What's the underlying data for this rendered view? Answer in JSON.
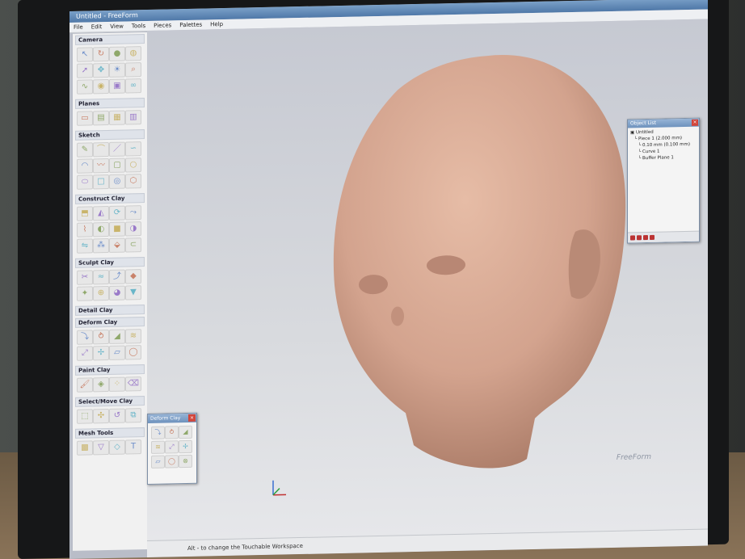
{
  "app": {
    "title": "Untitled - FreeForm",
    "menu": [
      "File",
      "Edit",
      "View",
      "Tools",
      "Pieces",
      "Palettes",
      "Help"
    ]
  },
  "palette": {
    "sections": [
      {
        "name": "Camera",
        "tools": [
          "select-icon",
          "rotate-view-icon",
          "sphere-icon",
          "globe-icon",
          "arrow-cursor-icon",
          "pan-icon",
          "light-icon",
          "zoom-icon",
          "path-icon",
          "camera-icon",
          "cube-icon",
          "loop-icon"
        ]
      },
      {
        "name": "Planes",
        "tools": [
          "plane-icon",
          "box-plane-icon",
          "color-plane-icon",
          "grid-plane-icon"
        ]
      },
      {
        "name": "Sketch",
        "tools": [
          "pencil-icon",
          "curve-icon",
          "line-icon",
          "spline-icon",
          "arc-icon",
          "wave-icon",
          "rect-icon",
          "circle-icon",
          "ellipse-icon",
          "square-icon",
          "ring-icon",
          "polygon-icon"
        ]
      },
      {
        "name": "Construct Clay",
        "tools": [
          "extrude-icon",
          "loft-icon",
          "revolve-icon",
          "sweep-icon",
          "wire-icon",
          "shell-icon",
          "block-icon",
          "blend-icon",
          "mirror-icon",
          "pattern-icon",
          "stamp-icon",
          "tube-icon"
        ]
      },
      {
        "name": "Sculpt Clay",
        "tools": [
          "carve-icon",
          "smooth-icon",
          "tug-icon",
          "emboss-icon",
          "spike-icon",
          "attract-icon",
          "wax-icon",
          "fill-icon"
        ]
      },
      {
        "name": "Detail Clay",
        "tools": []
      },
      {
        "name": "Deform Clay",
        "tools": [
          "bend-icon",
          "twist-icon",
          "taper-icon",
          "warp-icon",
          "scale-icon",
          "move-icon",
          "shear-icon",
          "inflate-icon"
        ]
      },
      {
        "name": "Paint Clay",
        "tools": [
          "brush-icon",
          "color-icon",
          "spray-icon",
          "eraser-icon"
        ]
      },
      {
        "name": "Select/Move Clay",
        "tools": [
          "select-clay-icon",
          "move-clay-icon",
          "rotate-clay-icon",
          "copy-clay-icon"
        ]
      },
      {
        "name": "Mesh Tools",
        "tools": [
          "mesh-icon",
          "reduce-icon",
          "weld-icon",
          "t-tool-icon"
        ]
      }
    ]
  },
  "object_list": {
    "title": "Object List",
    "items": [
      "Untitled",
      "Piece 1 (2.000 mm)",
      "0.10 mm (0.100 mm)",
      "Curve 1",
      "Buffer Plane 1"
    ]
  },
  "deform_popup": {
    "title": "Deform Clay",
    "tools": [
      "bend-icon",
      "twist-icon",
      "taper-icon",
      "warp-icon",
      "scale-icon",
      "move-icon",
      "shear-icon",
      "inflate-icon",
      "pinch-icon"
    ]
  },
  "status": {
    "text": "Alt - to change the Touchable Workspace"
  },
  "brand": "FreeForm",
  "colors": {
    "accent": "#4f78a8",
    "clay": "#d8a893",
    "close": "#d2453a"
  }
}
